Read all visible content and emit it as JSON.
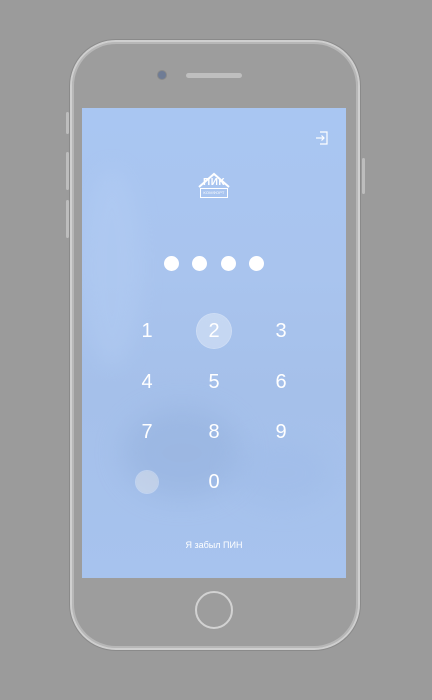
{
  "app": {
    "logo_text": "ПИК",
    "logo_subtext": "КОМФОРТ"
  },
  "pin": {
    "entered_count": 4,
    "length": 4
  },
  "keypad": {
    "keys": [
      "1",
      "2",
      "3",
      "4",
      "5",
      "6",
      "7",
      "8",
      "9",
      "0"
    ],
    "pressed_key": "2"
  },
  "icons": {
    "logout": "logout-icon",
    "fingerprint": "touch-id-icon"
  },
  "links": {
    "forgot_pin": "Я забыл ПИН"
  },
  "colors": {
    "screen_bg": "#a9c6f2",
    "text": "#ffffff",
    "device_frame": "#9d9d9d"
  }
}
